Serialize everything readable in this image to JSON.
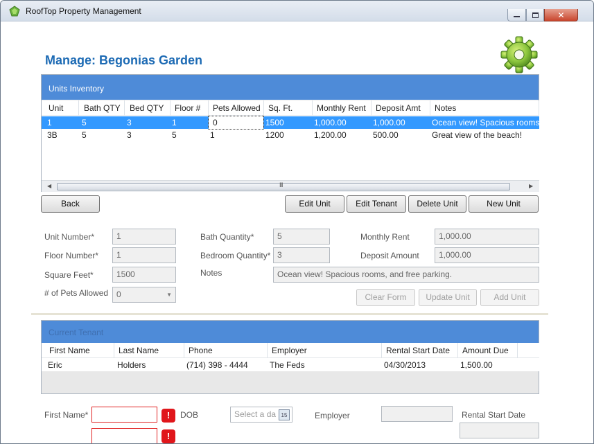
{
  "window": {
    "title": "RoofTop Property Management"
  },
  "page": {
    "title": "Manage: Begonias Garden"
  },
  "units_panel": {
    "header": "Units Inventory",
    "columns": [
      "Unit",
      "Bath QTY",
      "Bed QTY",
      "Floor #",
      "Pets Allowed",
      "Sq. Ft.",
      "Monthly Rent",
      "Deposit Amt",
      "Notes"
    ],
    "rows": [
      [
        "1",
        "5",
        "3",
        "1",
        "0",
        "1500",
        "1,000.00",
        "1,000.00",
        "Ocean view! Spacious rooms,"
      ],
      [
        "3B",
        "5",
        "3",
        "5",
        "1",
        "1200",
        "1,200.00",
        "500.00",
        "Great view of the beach!"
      ]
    ],
    "scroll_grip": "III"
  },
  "buttons": {
    "back": "Back",
    "edit_unit": "Edit Unit",
    "edit_tenant": "Edit Tenant",
    "delete_unit": "Delete Unit",
    "new_unit": "New Unit",
    "clear_form": "Clear Form",
    "update_unit": "Update Unit",
    "add_unit": "Add Unit"
  },
  "unit_form": {
    "unit_number": {
      "label": "Unit Number*",
      "value": "1"
    },
    "floor_number": {
      "label": "Floor Number*",
      "value": "1"
    },
    "square_feet": {
      "label": "Square Feet*",
      "value": "1500"
    },
    "pets_allowed": {
      "label": "# of Pets Allowed",
      "value": "0"
    },
    "bath_quantity": {
      "label": "Bath Quantity*",
      "value": "5"
    },
    "bedroom_quantity": {
      "label": "Bedroom Quantity*",
      "value": "3"
    },
    "notes": {
      "label": "Notes",
      "value": "Ocean view! Spacious rooms, and free parking."
    },
    "monthly_rent": {
      "label": "Monthly Rent",
      "value": "1,000.00"
    },
    "deposit_amount": {
      "label": "Deposit Amount",
      "value": "1,000.00"
    }
  },
  "tenant_panel": {
    "header": "Current Tenant",
    "columns": [
      "First Name",
      "Last Name",
      "Phone",
      "Employer",
      "Rental Start Date",
      "Amount Due"
    ],
    "rows": [
      [
        "Eric",
        "Holders",
        "(714) 398 - 4444",
        "The Feds",
        "04/30/2013",
        "1,500.00"
      ]
    ]
  },
  "tenant_form": {
    "first_name": {
      "label": "First Name*",
      "value": ""
    },
    "dob": {
      "label": "DOB",
      "placeholder": "Select a da",
      "calendar_day": "15"
    },
    "employer": {
      "label": "Employer",
      "value": ""
    },
    "rental_start": {
      "label": "Rental Start Date",
      "value": ""
    },
    "error_mark": "!"
  },
  "colors": {
    "accent": "#4e8bd8",
    "title": "#1c6ab4",
    "selection": "#3399ff",
    "error": "#e0161b"
  },
  "icons": [
    "app-icon",
    "gear-icon",
    "minimize-icon",
    "maximize-icon",
    "close-icon",
    "calendar-icon",
    "error-icon"
  ]
}
